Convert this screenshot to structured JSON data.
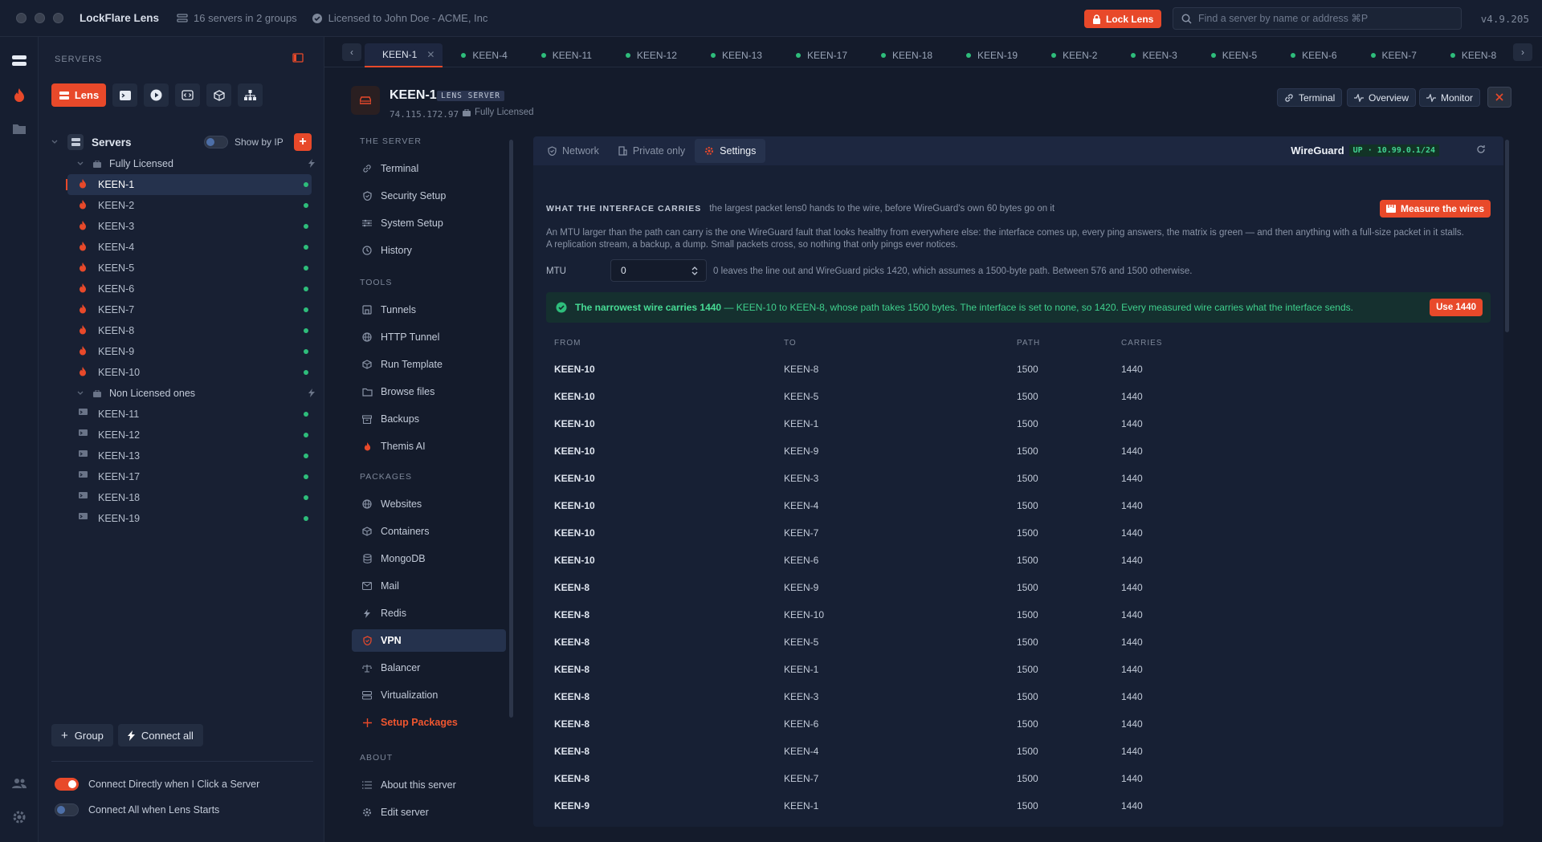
{
  "app": {
    "title": "LockFlare Lens",
    "servers_summary": "16 servers in 2 groups",
    "license": "Licensed to John Doe - ACME, Inc",
    "lock_label": "Lock Lens",
    "search_placeholder": "Find a server by name or address ⌘P",
    "version": "v4.9.205"
  },
  "sidebar": {
    "header": "SERVERS",
    "lens_label": "Lens",
    "servers_label": "Servers",
    "show_by_ip": "Show by IP",
    "groups": [
      {
        "name": "Fully Licensed",
        "servers": [
          "KEEN-1",
          "KEEN-2",
          "KEEN-3",
          "KEEN-4",
          "KEEN-5",
          "KEEN-6",
          "KEEN-7",
          "KEEN-8",
          "KEEN-9",
          "KEEN-10"
        ]
      },
      {
        "name": "Non Licensed ones",
        "servers": [
          "KEEN-11",
          "KEEN-12",
          "KEEN-13",
          "KEEN-17",
          "KEEN-18",
          "KEEN-19"
        ]
      }
    ],
    "group_btn": "Group",
    "connect_all_btn": "Connect all",
    "opt_connect_direct": "Connect Directly when I Click a Server",
    "opt_connect_all": "Connect All when Lens Starts"
  },
  "tabs": [
    "KEEN-1",
    "KEEN-4",
    "KEEN-11",
    "KEEN-12",
    "KEEN-13",
    "KEEN-17",
    "KEEN-18",
    "KEEN-19",
    "KEEN-2",
    "KEEN-3",
    "KEEN-5",
    "KEEN-6",
    "KEEN-7",
    "KEEN-8"
  ],
  "server": {
    "name": "KEEN-1",
    "badge": "LENS SERVER",
    "ip": "74.115.172.97",
    "license": "Fully Licensed",
    "btn_terminal": "Terminal",
    "btn_overview": "Overview",
    "btn_monitor": "Monitor"
  },
  "nav": {
    "the_server": "THE SERVER",
    "tools": "TOOLS",
    "packages": "PACKAGES",
    "about": "ABOUT",
    "server_items": [
      "Terminal",
      "Security Setup",
      "System Setup",
      "History"
    ],
    "tool_items": [
      "Tunnels",
      "HTTP Tunnel",
      "Run Template",
      "Browse files",
      "Backups",
      "Themis AI"
    ],
    "package_items": [
      "Websites",
      "Containers",
      "MongoDB",
      "Mail",
      "Redis",
      "VPN",
      "Balancer",
      "Virtualization",
      "Setup Packages"
    ],
    "about_items": [
      "About this server",
      "Edit server"
    ]
  },
  "content": {
    "tab_network": "Network",
    "tab_private": "Private only",
    "tab_settings": "Settings",
    "wg_label": "WireGuard",
    "wg_status": "UP · 10.99.0.1/24",
    "carries_title": "WHAT THE INTERFACE CARRIES",
    "carries_desc": "the largest packet lens0 hands to the wire, before WireGuard's own 60 bytes go on it",
    "measure_btn": "Measure the wires",
    "mtu_desc": "An MTU larger than the path can carry is the one WireGuard fault that looks healthy from everywhere else: the interface comes up, every ping answers, the matrix is green — and then anything with a full-size packet in it stalls. A replication stream, a backup, a dump. Small packets cross, so nothing that only pings ever notices.",
    "mtu_label": "MTU",
    "mtu_value": "0",
    "mtu_hint": "0 leaves the line out and WireGuard picks 1420, which assumes a 1500-byte path. Between 576 and 1500 otherwise.",
    "banner_bold": "The narrowest wire carries 1440",
    "banner_rest": " — KEEN-10 to KEEN-8, whose path takes 1500 bytes. The interface is set to none, so 1420. Every measured wire carries what the interface sends.",
    "use_btn": "Use 1440",
    "columns": [
      "FROM",
      "TO",
      "PATH",
      "CARRIES"
    ],
    "rows": [
      [
        "KEEN-10",
        "KEEN-8",
        "1500",
        "1440"
      ],
      [
        "KEEN-10",
        "KEEN-5",
        "1500",
        "1440"
      ],
      [
        "KEEN-10",
        "KEEN-1",
        "1500",
        "1440"
      ],
      [
        "KEEN-10",
        "KEEN-9",
        "1500",
        "1440"
      ],
      [
        "KEEN-10",
        "KEEN-3",
        "1500",
        "1440"
      ],
      [
        "KEEN-10",
        "KEEN-4",
        "1500",
        "1440"
      ],
      [
        "KEEN-10",
        "KEEN-7",
        "1500",
        "1440"
      ],
      [
        "KEEN-10",
        "KEEN-6",
        "1500",
        "1440"
      ],
      [
        "KEEN-8",
        "KEEN-9",
        "1500",
        "1440"
      ],
      [
        "KEEN-8",
        "KEEN-10",
        "1500",
        "1440"
      ],
      [
        "KEEN-8",
        "KEEN-5",
        "1500",
        "1440"
      ],
      [
        "KEEN-8",
        "KEEN-1",
        "1500",
        "1440"
      ],
      [
        "KEEN-8",
        "KEEN-3",
        "1500",
        "1440"
      ],
      [
        "KEEN-8",
        "KEEN-6",
        "1500",
        "1440"
      ],
      [
        "KEEN-8",
        "KEEN-4",
        "1500",
        "1440"
      ],
      [
        "KEEN-8",
        "KEEN-7",
        "1500",
        "1440"
      ],
      [
        "KEEN-9",
        "KEEN-1",
        "1500",
        "1440"
      ]
    ]
  },
  "colors": {
    "accent": "#e8492a",
    "ok": "#2ebd7b",
    "bg": "#141b2b"
  }
}
